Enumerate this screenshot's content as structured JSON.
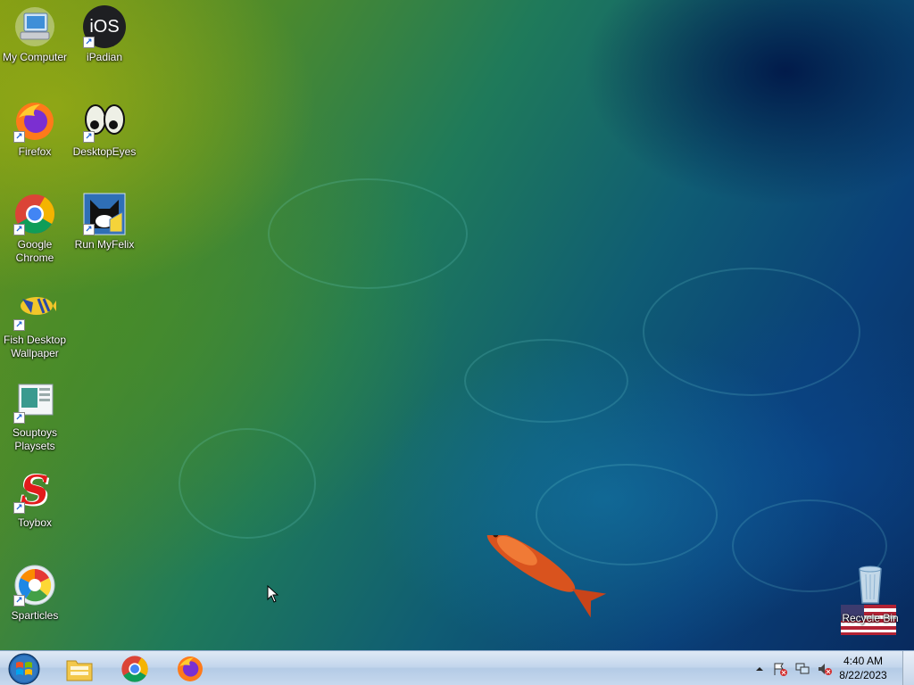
{
  "desktop": {
    "icons": [
      {
        "label": "My Computer",
        "icon": "computer-icon"
      },
      {
        "label": "iPadian",
        "icon": "ios-icon",
        "glyph": "iOS"
      },
      {
        "label": "Firefox",
        "icon": "firefox-icon"
      },
      {
        "label": "DesktopEyes",
        "icon": "eyes-icon"
      },
      {
        "label": "Google Chrome",
        "icon": "chrome-icon"
      },
      {
        "label": "Run MyFelix",
        "icon": "felix-icon"
      },
      {
        "label": "Fish Desktop Wallpaper",
        "icon": "fish-icon"
      },
      {
        "label": "Souptoys Playsets",
        "icon": "souptoys-icon"
      },
      {
        "label": "Toybox",
        "icon": "toybox-icon",
        "glyph": "S"
      },
      {
        "label": "Sparticles",
        "icon": "sparticles-icon"
      },
      {
        "label": "Recycle Bin",
        "icon": "recycle-bin-icon"
      }
    ]
  },
  "taskbar": {
    "start": "start-orb-icon",
    "pinned": [
      "file-explorer-icon",
      "chrome-icon",
      "firefox-icon"
    ],
    "clock": {
      "time": "4:40 AM",
      "date": "8/22/2023"
    }
  },
  "colors": {
    "taskbar": "#c3d6ec",
    "label": "#ffffff"
  }
}
